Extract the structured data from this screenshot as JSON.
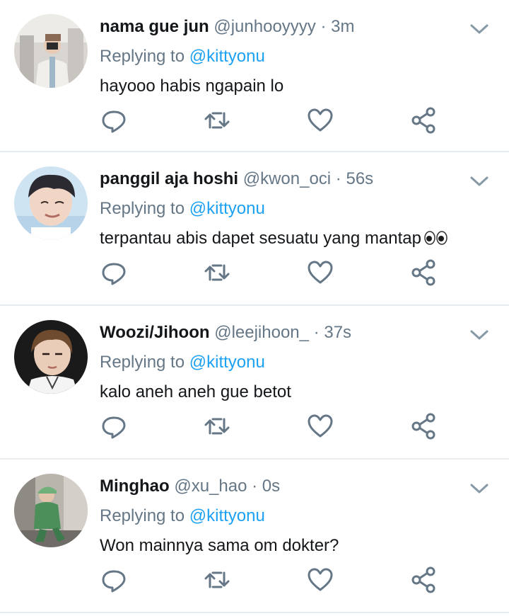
{
  "tweets": [
    {
      "display_name": "nama gue jun",
      "handle": "@junhooyyyy",
      "separator": "·",
      "time": "3m",
      "replying_prefix": "Replying to",
      "replying_to": "@kittyonu",
      "text": "hayooo habis ngapain lo",
      "emoji": ""
    },
    {
      "display_name": "panggil aja hoshi",
      "handle": "@kwon_oci",
      "separator": "·",
      "time": "56s",
      "replying_prefix": "Replying to",
      "replying_to": "@kittyonu",
      "text": "terpantau abis dapet sesuatu yang mantap",
      "emoji": "eyes-emoji"
    },
    {
      "display_name": "Woozi/Jihoon",
      "handle": "@leejihoon_",
      "separator": "·",
      "time": "37s",
      "replying_prefix": "Replying to",
      "replying_to": "@kittyonu",
      "text": "kalo aneh aneh gue betot",
      "emoji": ""
    },
    {
      "display_name": "Minghao",
      "handle": "@xu_hao",
      "separator": "·",
      "time": "0s",
      "replying_prefix": "Replying to",
      "replying_to": "@kittyonu",
      "text": "Won mainnya sama om dokter?",
      "emoji": ""
    }
  ],
  "icons": {
    "reply": "reply-icon",
    "retweet": "retweet-icon",
    "like": "heart-icon",
    "share": "share-icon",
    "menu": "chevron-down-icon"
  },
  "colors": {
    "text": "#14171a",
    "secondary": "#657786",
    "link": "#1da1f2",
    "divider": "#e6ecf0",
    "icon": "#657786"
  }
}
